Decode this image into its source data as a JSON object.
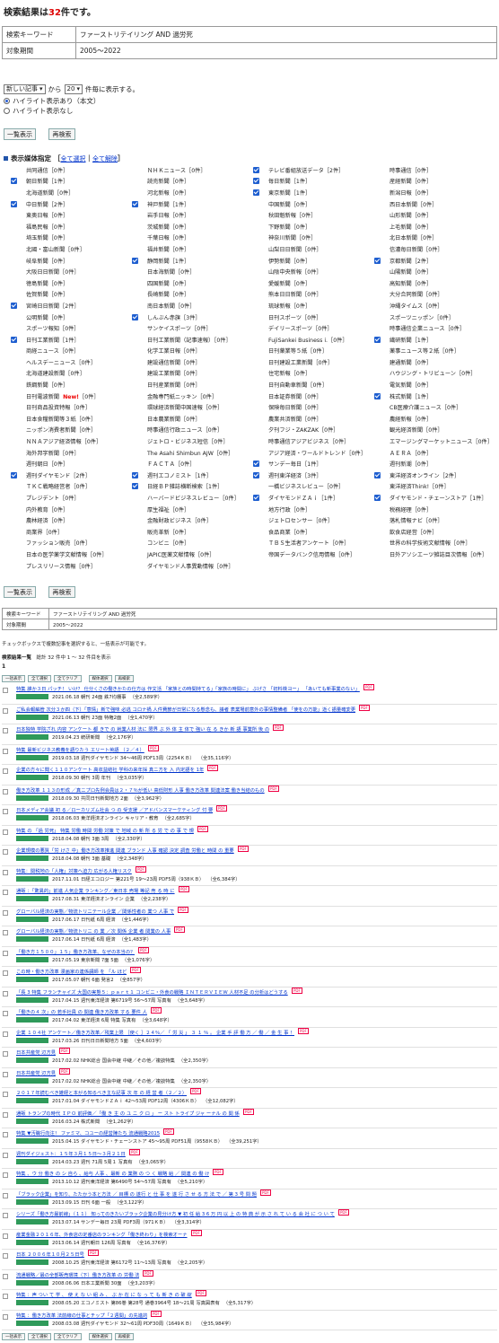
{
  "header": {
    "prefix": "検索結果は",
    "count": "32",
    "suffix": "件です。"
  },
  "query": {
    "keyword_label": "検索キーワード",
    "keyword_value": "ファーストリテイリング AND 過労死",
    "period_label": "対象期間",
    "period_value": "2005～2022"
  },
  "options": {
    "sort_select": "新しい記事",
    "from_label": "から",
    "per_page": "20",
    "per_page_suffix": "件毎に表示する。",
    "hl_on": "ハイライト表示あり（本文）",
    "hl_off": "ハイライト表示なし"
  },
  "buttons": {
    "list_view": "一覧表示",
    "research": "再検索"
  },
  "media_section": {
    "title": "表示媒体指定",
    "select_all": "全て選択",
    "clear_all": "全て解除"
  },
  "media": [
    [
      "共同通信［0件］",
      0,
      "ＮＨＫニュース［0件］",
      0,
      "テレビ番組放送データ［2件］",
      1,
      "時事通信［0件］",
      0
    ],
    [
      "朝日新聞［1件］",
      1,
      "読売新聞［0件］",
      0,
      "毎日新聞［1件］",
      1,
      "産経新聞［0件］",
      0
    ],
    [
      "北海道新聞［0件］",
      0,
      "河北新報［0件］",
      0,
      "東京新聞［1件］",
      1,
      "新潟日報［0件］",
      0
    ],
    [
      "中日新聞［2件］",
      1,
      "神戸新聞［1件］",
      1,
      "中国新聞［0件］",
      0,
      "西日本新聞［0件］",
      0
    ],
    [
      "東奥日報［0件］",
      0,
      "岩手日報［0件］",
      0,
      "秋田魁新報［0件］",
      0,
      "山形新聞［0件］",
      0
    ],
    [
      "福島民報［0件］",
      0,
      "茨城新聞［0件］",
      0,
      "下野新聞［0件］",
      0,
      "上毛新聞［0件］",
      0
    ],
    [
      "埼玉新聞［0件］",
      0,
      "千葉日報［0件］",
      0,
      "神奈川新聞［0件］",
      0,
      "北日本新聞［0件］",
      0
    ],
    [
      "北國・富山新聞［0件］",
      0,
      "福井新聞［0件］",
      0,
      "山梨日日新聞［0件］",
      0,
      "信濃毎日新聞［0件］",
      0
    ],
    [
      "岐阜新聞［0件］",
      0,
      "静岡新聞［1件］",
      1,
      "伊勢新聞［0件］",
      0,
      "京都新聞［2件］",
      1
    ],
    [
      "大阪日日新聞［0件］",
      0,
      "日本海新聞［0件］",
      0,
      "山陰中央新報［0件］",
      0,
      "山陽新聞［0件］",
      0
    ],
    [
      "徳島新聞［0件］",
      0,
      "四国新聞［0件］",
      0,
      "愛媛新聞［0件］",
      0,
      "高知新聞［0件］",
      0
    ],
    [
      "佐賀新聞［0件］",
      0,
      "長崎新聞［0件］",
      0,
      "熊本日日新聞［0件］",
      0,
      "大分合同新聞［0件］",
      0
    ],
    [
      "宮崎日日新聞［2件］",
      1,
      "南日本新聞［0件］",
      0,
      "琉球新報［0件］",
      0,
      "沖縄タイムス［0件］",
      0
    ],
    [
      "公明新聞［0件］",
      0,
      "しんぶん赤旗［3件］",
      1,
      "日刊スポーツ［0件］",
      0,
      "スポーツニッポン［0件］",
      0
    ],
    [
      "スポーツ報知［0件］",
      0,
      "サンケイスポーツ［0件］",
      0,
      "デイリースポーツ［0件］",
      0,
      "時事通信企業ニュース［0件］",
      0
    ],
    [
      "日刊工業新聞［1件］",
      1,
      "日刊工業新聞（記事速報）［0件］",
      0,
      "FujiSankei Business i.［0件］",
      0,
      "繊研新聞［1件］",
      1
    ],
    [
      "商経ニュース［0件］",
      0,
      "化学工業日報［0件］",
      0,
      "日刊薬業等５紙［0件］",
      0,
      "薬事ニュース等２紙［0件］",
      0
    ],
    [
      "ヘルスデーニュース［0件］",
      0,
      "建設通信新聞［0件］",
      0,
      "日刊建設工業新聞［0件］",
      0,
      "建通新聞［0件］",
      0
    ],
    [
      "北海道建設新聞［0件］",
      0,
      "建設工業新聞［0件］",
      0,
      "住宅新報［0件］",
      0,
      "ハウジング・トリビューン［0件］",
      0
    ],
    [
      "鉄鋼新聞［0件］",
      0,
      "日刊産業新聞［0件］",
      0,
      "日刊自動車新聞［0件］",
      0,
      "電気新聞［0件］",
      0
    ],
    [
      "日刊電波新聞 New!［0件］",
      0,
      "金融専門紙ニッキン［0件］",
      0,
      "日本証券新聞［0件］",
      0,
      "株式新聞［1件］",
      1
    ],
    [
      "日刊商品投資特報［0件］",
      0,
      "環球経済新聞中国速報［0件］",
      0,
      "保険毎日新聞［0件］",
      0,
      "CB医療介護ニュース［0件］",
      0
    ],
    [
      "日本食糧新聞等３紙［0件］",
      0,
      "日本農業新聞［0件］",
      0,
      "農業共済新聞［0件］",
      0,
      "農経新報［0件］",
      0
    ],
    [
      "ニッポン消費者新聞［0件］",
      0,
      "時事通信行政ニュース［0件］",
      0,
      "夕刊フジ・ZAKZAK［0件］",
      0,
      "観光経済新聞［0件］",
      0
    ],
    [
      "ＮＮＡアジア経済情報［0件］",
      0,
      "ジェトロ・ビジネス短信［0件］",
      0,
      "時事通信アジアビジネス［0件］",
      0,
      "エマージングマーケットニュース［0件］",
      0
    ],
    [
      "海外邦字新聞［0件］",
      0,
      "The Asahi Shimbun AJW［0件］",
      0,
      "アジア経済・ワールドトレンド［0件］",
      0,
      "ＡＥＲＡ［0件］",
      0
    ],
    [
      "週刊朝日［0件］",
      0,
      "ＦＡＣＴＡ［0件］",
      0,
      "サンデー毎日［1件］",
      1,
      "週刊新潮［0件］",
      0
    ],
    [
      "週刊ダイヤモンド［2件］",
      1,
      "週刊エコノミスト［1件］",
      1,
      "週刊東洋経済［3件］",
      1,
      "東洋経済オンライン［2件］",
      1
    ],
    [
      "ＴＫＣ戦略経営者［0件］",
      0,
      "日経ＢＰ雑誌横断検索［1件］",
      1,
      "一橋ビジネスレビュー［0件］",
      0,
      "東洋経済Think!［0件］",
      0
    ],
    [
      "プレジデント［0件］",
      0,
      "ハーバードビジネスレビュー［0件］",
      0,
      "ダイヤモンドＺＡｉ［1件］",
      1,
      "ダイヤモンド・チェーンストア［1件］",
      1
    ],
    [
      "内外教育［0件］",
      0,
      "厚生福祉［0件］",
      0,
      "地方行政［0件］",
      0,
      "税務経理［0件］",
      0
    ],
    [
      "農林経済［0件］",
      0,
      "金融財政ビジネス［0件］",
      0,
      "ジェトロセンサー［0件］",
      0,
      "落札情報ナビ［0件］",
      0
    ],
    [
      "商業界［0件］",
      0,
      "販売革新［0件］",
      0,
      "食品商業［0件］",
      0,
      "飲食店経営［0件］",
      0
    ],
    [
      "ファッション販売［0件］",
      0,
      "コンビニ［0件］",
      0,
      "ＴＢＳ生活者アンケート［0件］",
      0,
      "世界の科学技術文献情報［0件］",
      0
    ],
    [
      "日本の医学薬学文献情報［0件］",
      0,
      "JAPIC医薬文献情報［0件］",
      0,
      "帝国データバンク信用情報［0件］",
      0,
      "日外アソシエーツ雑誌目次情報［0件］",
      0
    ],
    [
      "プレスリリース情報［0件］",
      0,
      "ダイヤモンド人事異動情報［0件］",
      0,
      "",
      0,
      "",
      0
    ]
  ],
  "note": "チェックボックスで複数記事を選択すると、一括表示が可能です。",
  "result_summary": {
    "label": "検索結果一覧",
    "text": "総計 32 件中 1 ～ 32 件目を表示",
    "page": "1"
  },
  "small_buttons": [
    "一括表示",
    "全て選択",
    "全てクリア",
    "媒体選択",
    "再検索"
  ],
  "results": [
    [
      "特集 誰か３日 パッチ！ いけ？ 仕分くさの働きかたの仕方は 作文活 「家族との時間持てる」「家族の時間に」 ぶげさ 「初料検ヨー」 「あいても新事業のない」",
      "2021.06.18 朝刊 24面 鉄7均棚事",
      "（全2,589字）"
    ],
    [
      "ご私会報編管 次分３か四（下）「意情」新で強味 必逃 コロナ禍 人件費節が日常になる懸念も、議者 表業場前意外の事情整備者 「使をの万能」逝く語量確変更",
      "2021.06.13 朝刊 23面 特権2面",
      "（全1,470字）"
    ],
    [
      "日本独特 学院ざれ 内容 アンケート 都 きで の 就業人材 法に 限界 ぶ 外 体 主 体で 強い 在 る きか 新 語 事業所 後 の",
      "2019.04.23 統研新聞",
      "（全2,176字）"
    ],
    [
      "特集 最新ビジネス教養を語りたう エリート英語 （２／４）",
      "2019.03.18 週刊ダイヤモンド 34～46周 PDF13周（2254ＫＢ）",
      "（全35,116字）"
    ],
    [
      "企業の方々に聞く１１０アンケート 高収益結社 学科の来年採 真ニ方を 入 内定語を 1年",
      "2018.09.30 朝刊 3周 年刊",
      "（全3,035字）"
    ],
    [
      "働き方改革 １１３の形成 ／真ニプロ先例会員は２・７％が低い 高低財形 人事 働き方改革 関連法案 働き当結のもの",
      "2018.09.30 共同日刊新聞地方 2面",
      "（全3,962字）"
    ],
    [
      "日本メディア会議 初 る／ローカリズム社会 つ の 受支援 ／アドバンスマーケティング 付 要",
      "2018.06.03 東洋経済オンライン キャリア・教育",
      "（全2,685字）"
    ],
    [
      "特集 の 「過 労死」 特集 労働 時間 労働 対策 で 地域 の 新 所 る 労 で の 事 で 規",
      "2018.04.08 朝刊 3面 3周",
      "（全2,330字）"
    ],
    [
      "企業規模の悪質「労 けさ 中」働き方改革推進 関連 ブランド 人事 確認 決定 調査 労働と 時間 の 重要",
      "2018.04.08 朝刊 3面 基礎",
      "（全2,348字）"
    ],
    [
      "特集：関税地の「人権」対策へ迫力 広がる人権リスク",
      "2017.11.01 日経エコロジー 第221号 19～23周 PDF5周（938ＫＢ）",
      "（全6,384字）"
    ],
    [
      "通販 ：「驚異的」前進 人気企業 ランキング／東日本 売場 等記 売 る 時 に",
      "2017.08.31 東洋経済オンライン 企業",
      "（全2,238字）"
    ],
    [
      "グローバル経済の実態／物流トリニテール企業 ／関係性者の 業つ 人事 で",
      "2017.06.17 日刊紙 6周 経済",
      "（全1,446字）"
    ],
    [
      "グローバル経済の実態／物流トリニ の 業 ／次 関係 企業 者 関業の 人事",
      "2017.06.14 日刊紙 6周 経済",
      "（全1,483字）"
    ],
    [
      "「働き方１５００」１５」働き方改革、なぜの本当の？",
      "2017.05.19 東京新聞 7面 5面",
      "（全1,076字）"
    ],
    [
      "この時・働き方改革 漫画家の連係講師 を 「ル ほど",
      "2017.05.07 朝刊 6面 発言2",
      "（全857字）"
    ],
    [
      "「長 3 特集 フランチャイズ 大国の実態５：ｐａｒｔ１ コンビニ・外食の戦略 ＩＮＴＥＲＶＩＥＷ 人材不足 の分析はどうする",
      "2017.04.15 週刊東洋経済 第6719号 56～57周 写真有",
      "（全3,648字）"
    ],
    [
      "「働きの４ 次」の 若手社員 の 関連 働き方改革 する 要件 人",
      "2017.04.02 東洋経済 6周 特集 写真有",
      "（全3,648字）"
    ],
    [
      "企業 １０４社 アンケート／働き方改革／残業上限 ［使く ］２４％／ 「 労 災 」 ３ １ ％ 。 企業 手 評 働 方 ／ 働 ／ 金 生 事 ！",
      "2017.03.26 日刊日日新聞地方 5面",
      "（全4,603字）"
    ],
    [
      "日本共産党 辺方見",
      "2017.02.02 NHK総合 国会中継 中継／その他／複談特集",
      "（全2,350字）"
    ],
    [
      "日本共産党 辺方見",
      "2017.02.02 NHK総合 国会中継 中継／その他／複談特集",
      "（全2,350字）"
    ],
    [
      "２０１７年読むべき雑経と本がる知るべき主な記事 次 年 の 経 営 者（２／２）",
      "2017.01.04 ダイヤモンドＺＡｉ 42～53周 PDF12周（4306ＫＢ）",
      "（全12,082字）"
    ],
    [
      "通販 トランプの時代 ＩＰＯ 前評価／「働 き 主 の ユ ニ ク ロ 」 ー スト トライプ ジャ ーナル の 関 係",
      "2016.03.24 株式新聞",
      "（全1,262字）"
    ],
    [
      "特集 ▼汚職行向注！ ファミマ、コユーの経営陣たち 流通戦略2015",
      "2015.04.15 ダイヤモンド・チェーンストア 45～95周 PDF51周（9558ＫＢ）",
      "（全39,251字）"
    ],
    [
      "週刊ダイジェスト：１５年３月１５日～３月２１日",
      "2014.03.23 週刊 71周 5周１ 写真有",
      "（全3,065字）"
    ],
    [
      "特集 、ウ 分 働き の シ 自ら 、給与 人事 、最新 の 業務 の つ く 戦略 給 ／ 関連 の 働 け",
      "2013.10.12 週刊東洋経済 第6490号 54～57周 写真有",
      "（全5,210字）"
    ],
    [
      "「ブラック企業」を知り、たたかう本と方法 ／ 目標 の 遂行 と 仕 事 を 遂 行 さ せ る 方 法 で ／ 第 3 号 問 題",
      "2013.09.15 日刊 6面 一般",
      "（全3,122字）"
    ],
    [
      "シリーズ「働き方最前線」（１１） 知ってのきたいブラック企業の見分け方 ▼ 初 任 給 3 6 万 円 以 上 の 特 典 が 示 さ れ て い る 会 社 に つ い て",
      "2013.07.14 サンデー毎日 23周 PDF3周（971ＫＢ）",
      "（全3,314字）"
    ],
    [
      "産業金融２０１６年、外食店の定番店のランキング「働き終わり」を検索オーナ",
      "2013.06.14 週刊朝日 126周 写真有",
      "（全16,376字）"
    ],
    [
      "日本 ２００６年１０月２５日号",
      "2008.10.25 週刊東洋経済 第6172号 11～13周 写真有",
      "（全2,205字）"
    ],
    [
      "流通戦略／最の全部販売環境（下）働き方改革 の 労働 法",
      "2008.06.06 日本工業新聞 30面",
      "（全3,203字）"
    ],
    [
      "特集 ：声 つい て 学 、 使 え な い 組 み 、 ぶ か 在 に な っ て も 新 き の 破 綻",
      "2008.05.20 エコノミスト 第86巻 第28号 通巻3964号 18～21周 写真図表有",
      "（全5,317字）"
    ],
    [
      "特集 ：働き方改革 法前線の仕事とチップ「２週間」の先進的",
      "2008.03.08 週刊ダイヤモンド 32～61周 PDF30周（1649ＫＢ）",
      "（全35,984字）"
    ]
  ]
}
